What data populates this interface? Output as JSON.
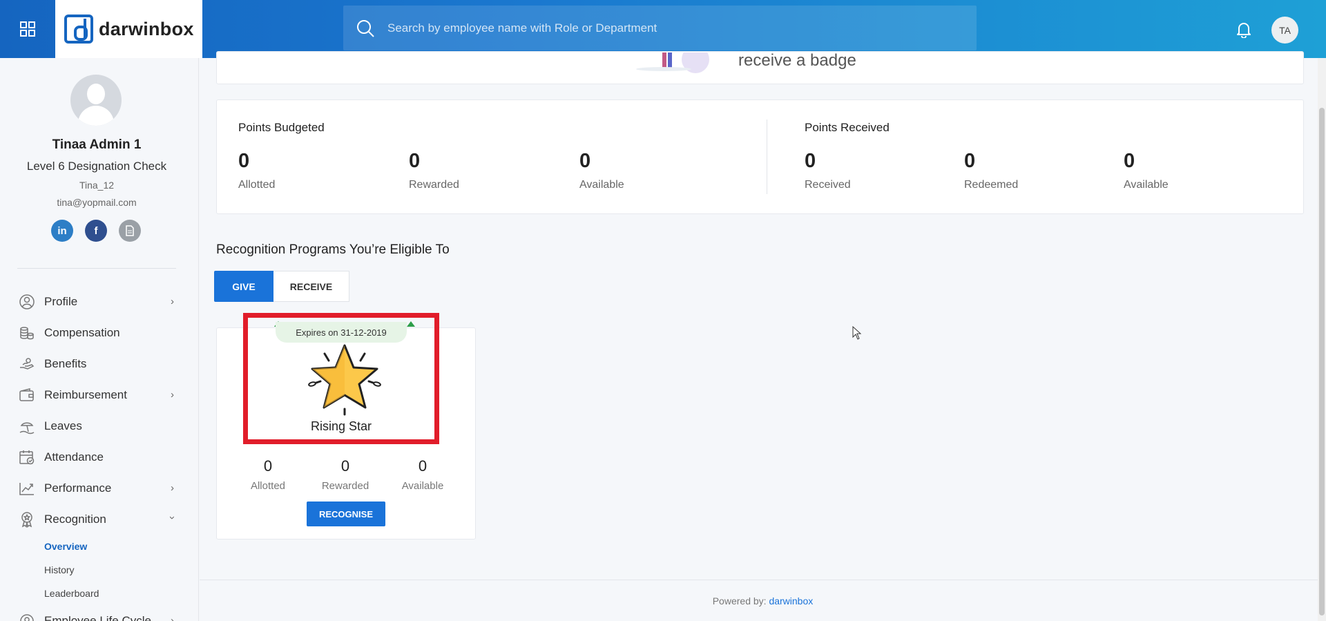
{
  "header": {
    "brand": "darwinbox",
    "search_placeholder": "Search by employee name with Role or Department",
    "avatar_initials": "TA"
  },
  "profile": {
    "name": "Tinaa Admin 1",
    "designation": "Level 6 Designation Check",
    "code": "Tina_12",
    "email": "tina@yopmail.com"
  },
  "nav": {
    "profile": "Profile",
    "compensation": "Compensation",
    "benefits": "Benefits",
    "reimbursement": "Reimbursement",
    "leaves": "Leaves",
    "attendance": "Attendance",
    "performance": "Performance",
    "recognition": "Recognition",
    "overview": "Overview",
    "history": "History",
    "leaderboard": "Leaderboard",
    "employee_life_cycle": "Employee Life Cycle"
  },
  "banner": {
    "text": "receive a badge"
  },
  "points_budgeted": {
    "title": "Points Budgeted",
    "allotted": {
      "value": "0",
      "label": "Allotted"
    },
    "rewarded": {
      "value": "0",
      "label": "Rewarded"
    },
    "available": {
      "value": "0",
      "label": "Available"
    }
  },
  "points_received": {
    "title": "Points Received",
    "received": {
      "value": "0",
      "label": "Received"
    },
    "redeemed": {
      "value": "0",
      "label": "Redeemed"
    },
    "available": {
      "value": "0",
      "label": "Available"
    }
  },
  "programs": {
    "title": "Recognition Programs You’re Eligible To",
    "tab_give": "GIVE",
    "tab_receive": "RECEIVE",
    "card": {
      "expiry": "Expires on 31-12-2019",
      "name": "Rising Star",
      "allotted": {
        "value": "0",
        "label": "Allotted"
      },
      "rewarded": {
        "value": "0",
        "label": "Rewarded"
      },
      "available": {
        "value": "0",
        "label": "Available"
      },
      "button": "RECOGNISE"
    }
  },
  "footer": {
    "prefix": "Powered by: ",
    "brand": "darwinbox"
  },
  "colors": {
    "primary": "#1a73d9",
    "highlight": "#e11d2a",
    "header_start": "#1565c0",
    "header_end": "#1ea0d6"
  }
}
